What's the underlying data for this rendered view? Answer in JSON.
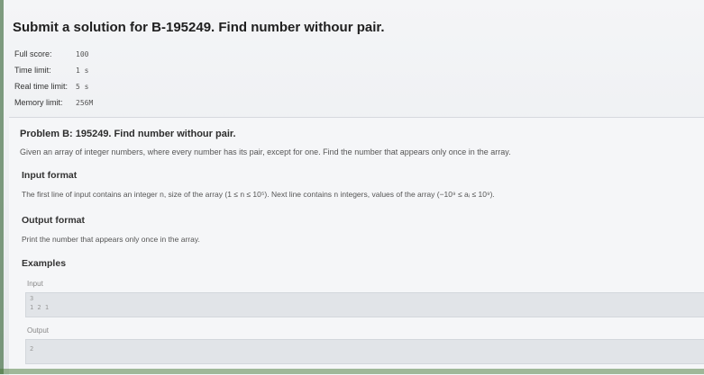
{
  "header": {
    "title": "Submit a solution for B-195249. Find number withour pair."
  },
  "meta": [
    {
      "label": "Full score:",
      "value": "100"
    },
    {
      "label": "Time limit:",
      "value": "1 s"
    },
    {
      "label": "Real time limit:",
      "value": "5 s"
    },
    {
      "label": "Memory limit:",
      "value": "256M"
    }
  ],
  "problem": {
    "title": "Problem B: 195249. Find number withour pair.",
    "description": "Given an array of integer numbers, where every number has its pair, except for one. Find the number that appears only once in the array.",
    "input_format_heading": "Input format",
    "input_format_text": "The first line of input contains an integer n, size of the array (1 ≤ n ≤ 10⁵). Next line contains n integers, values of the array (−10⁹ ≤ aᵢ ≤ 10⁹).",
    "output_format_heading": "Output format",
    "output_format_text": "Print the number that appears only once in the array.",
    "examples_heading": "Examples",
    "input_label": "Input",
    "input_lines": [
      "3",
      "1 2 1"
    ],
    "output_label": "Output",
    "output_lines": [
      "2"
    ]
  }
}
